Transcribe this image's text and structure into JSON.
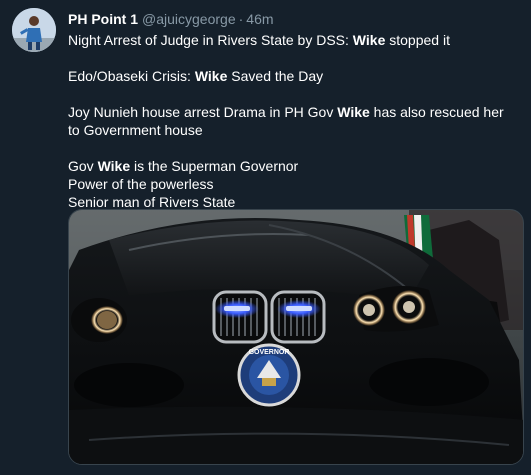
{
  "author": {
    "display_name": "PH Point 1",
    "handle": "@ajuicygeorge",
    "separator": "·",
    "time": "46m"
  },
  "tweet": {
    "p1": {
      "pre": "Night Arrest of Judge in Rivers State by DSS: ",
      "kw": "Wike",
      "post": " stopped it"
    },
    "p2": {
      "pre": "Edo/Obaseki Crisis: ",
      "kw": "Wike",
      "post": " Saved the Day"
    },
    "p3": {
      "pre": "Joy Nunieh house arrest Drama in PH Gov ",
      "kw": "Wike",
      "post": " has also rescued her to Government house"
    },
    "p4_l1": {
      "pre": "Gov ",
      "kw": "Wike",
      "post": " is the Superman Governor"
    },
    "p4_l2": "Power of the powerless",
    "p4_l3": "Senior man of Rivers State"
  },
  "media": {
    "emblem_text": "GOVERNOR"
  },
  "colors": {
    "background": "#15202b",
    "muted_text": "#8899a6",
    "border": "#38444d"
  }
}
